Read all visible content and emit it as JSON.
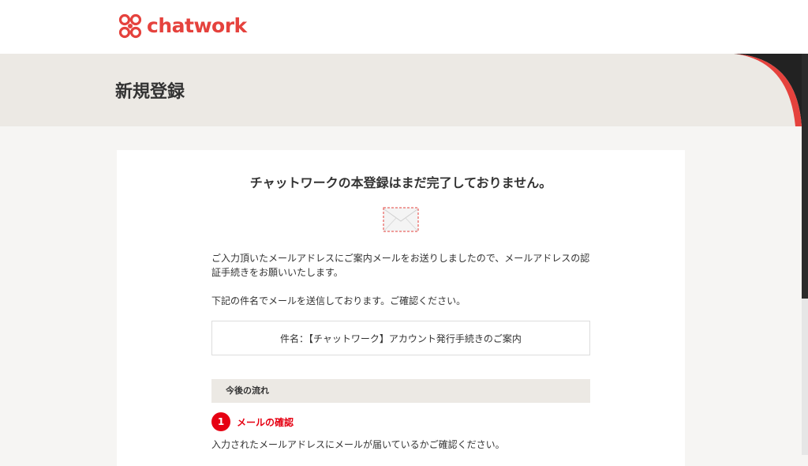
{
  "header": {
    "logo_text": "chatwork",
    "brand_color": "#e5423d",
    "logo_icon": "chatwork-logo-icon"
  },
  "hero": {
    "title": "新規登録"
  },
  "main": {
    "title": "チャットワークの本登録はまだ完了しておりません。",
    "envelope_icon": "envelope-icon",
    "paragraph_1": "ご入力頂いたメールアドレスにご案内メールをお送りしましたので、メールアドレスの認証手続きをお願いいたします。",
    "paragraph_2": "下記の件名でメールを送信しております。ご確認ください。",
    "subject": "件名：【チャットワーク】アカウント発行手続きのご案内",
    "flow_heading": "今後の流れ",
    "steps": [
      {
        "number": "1",
        "title": "メールの確認",
        "description": "入力されたメールアドレスにメールが届いているかご確認ください。"
      }
    ],
    "accent_color": "#e60012"
  }
}
